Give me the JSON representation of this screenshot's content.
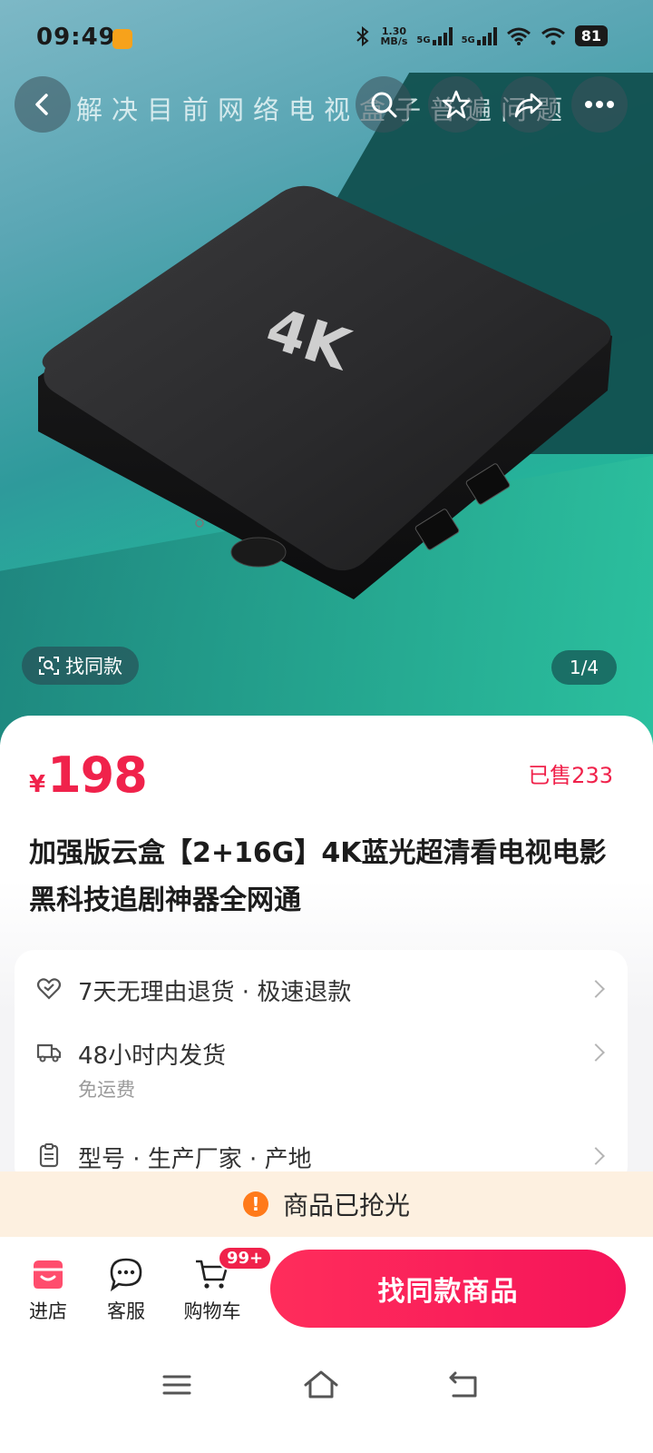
{
  "status_bar": {
    "time": "09:49",
    "net_speed_value": "1.30",
    "net_speed_unit": "MB/s",
    "signal1_label": "5G",
    "signal2_label": "5G",
    "battery": "81"
  },
  "hero": {
    "slogan": "解决目前网络电视盒子普遍问题",
    "product_mark": "4K",
    "find_same_label": "找同款",
    "pager": "1/4"
  },
  "product": {
    "currency": "¥",
    "price": "198",
    "sold": "已售233",
    "title": "加强版云盒【2+16G】4K蓝光超清看电视电影黑科技追剧神器全网通"
  },
  "services": [
    {
      "icon": "heart-shield-icon",
      "text": "7天无理由退货 · 极速退款",
      "sub": ""
    },
    {
      "icon": "delivery-truck-icon",
      "text": "48小时内发货",
      "sub": "免运费"
    },
    {
      "icon": "clipboard-icon",
      "text": "型号 · 生产厂家 · 产地",
      "sub": ""
    }
  ],
  "soldout": {
    "text": "商品已抢光"
  },
  "bottom_bar": {
    "store_label": "进店",
    "service_label": "客服",
    "cart_label": "购物车",
    "cart_badge": "99+",
    "cta_label": "找同款商品"
  },
  "colors": {
    "accent": "#f0224b",
    "soldout_bg": "#fdf0e0",
    "warn": "#ff7a1a"
  }
}
